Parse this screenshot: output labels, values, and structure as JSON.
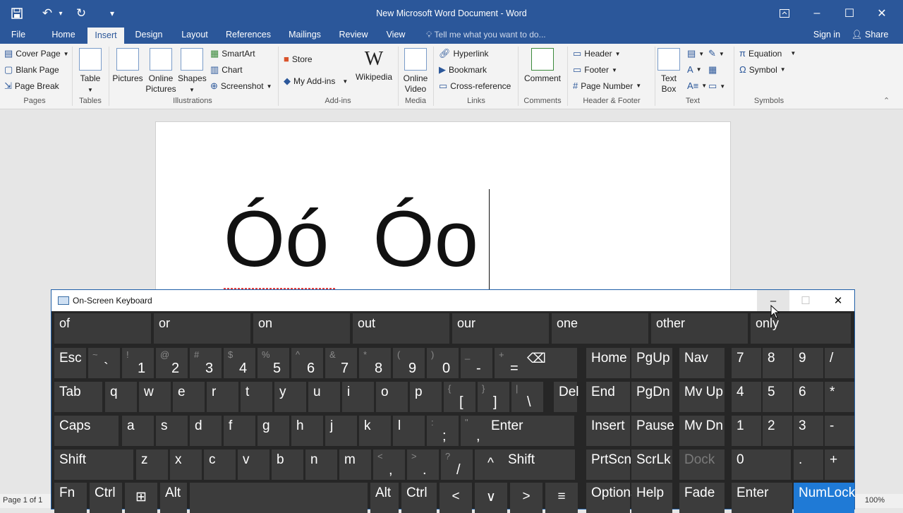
{
  "window": {
    "title": "New Microsoft Word Document - Word"
  },
  "tabs": [
    {
      "label": "File"
    },
    {
      "label": "Home"
    },
    {
      "label": "Insert"
    },
    {
      "label": "Design"
    },
    {
      "label": "Layout"
    },
    {
      "label": "References"
    },
    {
      "label": "Mailings"
    },
    {
      "label": "Review"
    },
    {
      "label": "View"
    }
  ],
  "tell_me": "Tell me what you want to do...",
  "account": {
    "sign_in": "Sign in",
    "share": "Share"
  },
  "ribbon": {
    "pages": {
      "label": "Pages",
      "items": [
        "Cover Page",
        "Blank Page",
        "Page Break"
      ]
    },
    "tables": {
      "label": "Tables",
      "table": "Table"
    },
    "illustrations": {
      "label": "Illustrations",
      "pictures": "Pictures",
      "online_pictures_1": "Online",
      "online_pictures_2": "Pictures",
      "shapes": "Shapes",
      "smartart": "SmartArt",
      "chart": "Chart",
      "screenshot": "Screenshot"
    },
    "addins": {
      "label": "Add-ins",
      "store": "Store",
      "my_addins": "My Add-ins",
      "wikipedia": "Wikipedia"
    },
    "media": {
      "label": "Media",
      "online_video_1": "Online",
      "online_video_2": "Video"
    },
    "links": {
      "label": "Links",
      "hyperlink": "Hyperlink",
      "bookmark": "Bookmark",
      "cross_reference": "Cross-reference"
    },
    "comments": {
      "label": "Comments",
      "comment": "Comment"
    },
    "header_footer": {
      "label": "Header & Footer",
      "header": "Header",
      "footer": "Footer",
      "page_number": "Page Number"
    },
    "text": {
      "label": "Text",
      "text_box_1": "Text",
      "text_box_2": "Box"
    },
    "symbols": {
      "label": "Symbols",
      "equation": "Equation",
      "symbol": "Symbol"
    }
  },
  "document": {
    "text": "Óó  Óo"
  },
  "status": {
    "page": "Page 1 of 1",
    "zoom": "100%"
  },
  "osk": {
    "title": "On-Screen Keyboard",
    "predictions": [
      "of",
      "or",
      "on",
      "out",
      "our",
      "one",
      "other",
      "only"
    ],
    "rows": [
      [
        {
          "main": "Esc"
        },
        {
          "shift": "~",
          "main": "`"
        },
        {
          "shift": "!",
          "main": "1"
        },
        {
          "shift": "@",
          "main": "2"
        },
        {
          "shift": "#",
          "main": "3"
        },
        {
          "shift": "$",
          "main": "4"
        },
        {
          "shift": "%",
          "main": "5"
        },
        {
          "shift": "^",
          "main": "6"
        },
        {
          "shift": "&",
          "main": "7"
        },
        {
          "shift": "*",
          "main": "8"
        },
        {
          "shift": "(",
          "main": "9"
        },
        {
          "shift": ")",
          "main": "0"
        },
        {
          "shift": "_",
          "main": "-"
        },
        {
          "shift": "+",
          "main": "="
        },
        {
          "main": "⌫"
        },
        {
          "main": "Home"
        },
        {
          "main": "PgUp"
        },
        {
          "main": "Nav"
        },
        {
          "main": "7"
        },
        {
          "main": "8"
        },
        {
          "main": "9"
        },
        {
          "main": "/"
        }
      ],
      [
        {
          "main": "Tab"
        },
        {
          "main": "q"
        },
        {
          "main": "w"
        },
        {
          "main": "e"
        },
        {
          "main": "r"
        },
        {
          "main": "t"
        },
        {
          "main": "y"
        },
        {
          "main": "u"
        },
        {
          "main": "i"
        },
        {
          "main": "o"
        },
        {
          "main": "p"
        },
        {
          "shift": "{",
          "main": "["
        },
        {
          "shift": "}",
          "main": "]"
        },
        {
          "shift": "|",
          "main": "\\"
        },
        {
          "main": "Del"
        },
        {
          "main": "End"
        },
        {
          "main": "PgDn"
        },
        {
          "main": "Mv Up"
        },
        {
          "main": "4"
        },
        {
          "main": "5"
        },
        {
          "main": "6"
        },
        {
          "main": "*"
        }
      ],
      [
        {
          "main": "Caps"
        },
        {
          "main": "a"
        },
        {
          "main": "s"
        },
        {
          "main": "d"
        },
        {
          "main": "f"
        },
        {
          "main": "g"
        },
        {
          "main": "h"
        },
        {
          "main": "j"
        },
        {
          "main": "k"
        },
        {
          "main": "l"
        },
        {
          "shift": ":",
          "main": ";"
        },
        {
          "shift": "\"",
          "main": ","
        },
        {
          "main": "Enter"
        },
        {
          "main": "Insert"
        },
        {
          "main": "Pause"
        },
        {
          "main": "Mv Dn"
        },
        {
          "main": "1"
        },
        {
          "main": "2"
        },
        {
          "main": "3"
        },
        {
          "main": "-"
        }
      ],
      [
        {
          "main": "Shift"
        },
        {
          "main": "z"
        },
        {
          "main": "x"
        },
        {
          "main": "c"
        },
        {
          "main": "v"
        },
        {
          "main": "b"
        },
        {
          "main": "n"
        },
        {
          "main": "m"
        },
        {
          "shift": "<",
          "main": ","
        },
        {
          "shift": ">",
          "main": "."
        },
        {
          "shift": "?",
          "main": "/"
        },
        {
          "main": "^"
        },
        {
          "main": "Shift"
        },
        {
          "main": "PrtScn"
        },
        {
          "main": "ScrLk"
        },
        {
          "main": "Dock"
        },
        {
          "main": "0"
        },
        {
          "main": "."
        },
        {
          "main": "+"
        }
      ],
      [
        {
          "main": "Fn"
        },
        {
          "main": "Ctrl"
        },
        {
          "main": "⊞"
        },
        {
          "main": "Alt"
        },
        {
          "main": ""
        },
        {
          "main": "Alt"
        },
        {
          "main": "Ctrl"
        },
        {
          "main": "<"
        },
        {
          "main": "∨"
        },
        {
          "main": ">"
        },
        {
          "main": "≡"
        },
        {
          "main": "Options"
        },
        {
          "main": "Help"
        },
        {
          "main": "Fade"
        },
        {
          "main": "Enter"
        },
        {
          "main": "NumLock"
        }
      ]
    ]
  },
  "colors": {
    "accent": "#2b579a",
    "osk_bg": "#262626",
    "osk_key": "#3c3c3c",
    "numlock_active": "#1f7ad6"
  }
}
